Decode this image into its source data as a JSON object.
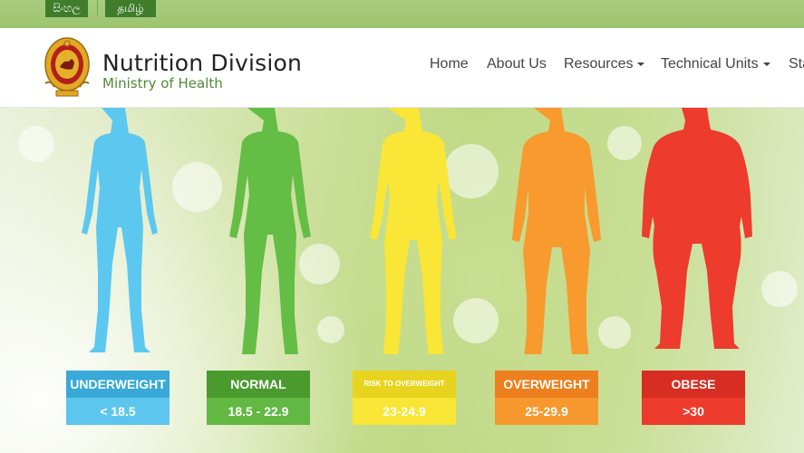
{
  "lang": {
    "sinhala": "සිංහල",
    "tamil": "தமிழ்"
  },
  "header": {
    "title": "Nutrition Division",
    "subtitle": "Ministry of Health"
  },
  "nav": [
    {
      "label": "Home"
    },
    {
      "label": "About Us"
    },
    {
      "label": "Resources",
      "dropdown": true
    },
    {
      "label": "Technical Units",
      "dropdown": true
    },
    {
      "label": "Sta"
    }
  ],
  "bmi": [
    {
      "category": "UNDERWEIGHT",
      "range": "< 18.5",
      "color": "#5cc8ef",
      "top_color": "#38a9d8",
      "bottom_color": "#5dc6ee"
    },
    {
      "category": "NORMAL",
      "range": "18.5 - 22.9",
      "color": "#64bd45",
      "top_color": "#4b9a2e",
      "bottom_color": "#62b842"
    },
    {
      "category": "RISK TO OVERWEIGHT",
      "range": "23-24.9",
      "color": "#f9e636",
      "top_color": "#e8d41e",
      "bottom_color": "#f9e535"
    },
    {
      "category": "OVERWEIGHT",
      "range": "25-29.9",
      "color": "#f89a2e",
      "top_color": "#ed7f1d",
      "bottom_color": "#f6982d"
    },
    {
      "category": "OBESE",
      "range": ">30",
      "color": "#ed3b2e",
      "top_color": "#d82d22",
      "bottom_color": "#ec3a2c"
    }
  ]
}
